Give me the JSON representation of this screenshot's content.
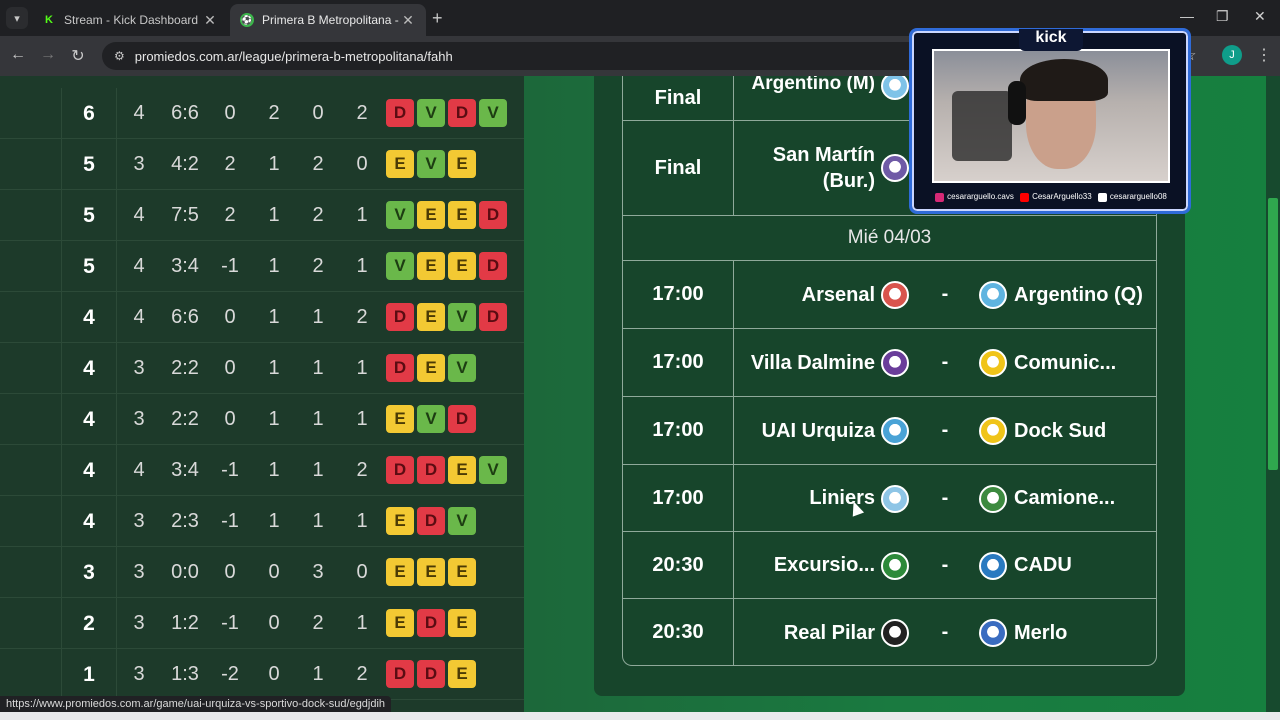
{
  "browser": {
    "tabs": [
      {
        "title": "Stream - Kick Dashboard",
        "favicon": "K",
        "active": false
      },
      {
        "title": "Primera B Metropolitana - POSI",
        "favicon": "⚽",
        "active": true
      }
    ],
    "new_tab_glyph": "+",
    "url": "promiedos.com.ar/league/primera-b-metropolitana/fahh",
    "profile_initial": "J",
    "status_link": "https://www.promiedos.com.ar/game/uai-urquiza-vs-sportivo-dock-sud/egdjdih"
  },
  "standings": {
    "rows": [
      {
        "pts": "6",
        "pj": "4",
        "goals": "6:6",
        "diff": "0",
        "g": "2",
        "e": "0",
        "p": "2",
        "form": [
          "D",
          "V",
          "D",
          "V"
        ]
      },
      {
        "pts": "5",
        "pj": "3",
        "goals": "4:2",
        "diff": "2",
        "g": "1",
        "e": "2",
        "p": "0",
        "form": [
          "E",
          "V",
          "E"
        ]
      },
      {
        "pts": "5",
        "pj": "4",
        "goals": "7:5",
        "diff": "2",
        "g": "1",
        "e": "2",
        "p": "1",
        "form": [
          "V",
          "E",
          "E",
          "D"
        ]
      },
      {
        "pts": "5",
        "pj": "4",
        "goals": "3:4",
        "diff": "-1",
        "g": "1",
        "e": "2",
        "p": "1",
        "form": [
          "V",
          "E",
          "E",
          "D"
        ]
      },
      {
        "pts": "4",
        "pj": "4",
        "goals": "6:6",
        "diff": "0",
        "g": "1",
        "e": "1",
        "p": "2",
        "form": [
          "D",
          "E",
          "V",
          "D"
        ]
      },
      {
        "pts": "4",
        "pj": "3",
        "goals": "2:2",
        "diff": "0",
        "g": "1",
        "e": "1",
        "p": "1",
        "form": [
          "D",
          "E",
          "V"
        ]
      },
      {
        "pts": "4",
        "pj": "3",
        "goals": "2:2",
        "diff": "0",
        "g": "1",
        "e": "1",
        "p": "1",
        "form": [
          "E",
          "V",
          "D"
        ]
      },
      {
        "pts": "4",
        "pj": "4",
        "goals": "3:4",
        "diff": "-1",
        "g": "1",
        "e": "1",
        "p": "2",
        "form": [
          "D",
          "D",
          "E",
          "V"
        ]
      },
      {
        "pts": "4",
        "pj": "3",
        "goals": "2:3",
        "diff": "-1",
        "g": "1",
        "e": "1",
        "p": "1",
        "form": [
          "E",
          "D",
          "V"
        ]
      },
      {
        "pts": "3",
        "pj": "3",
        "goals": "0:0",
        "diff": "0",
        "g": "0",
        "e": "3",
        "p": "0",
        "form": [
          "E",
          "E",
          "E"
        ]
      },
      {
        "pts": "2",
        "pj": "3",
        "goals": "1:2",
        "diff": "-1",
        "g": "0",
        "e": "2",
        "p": "1",
        "form": [
          "E",
          "D",
          "E"
        ]
      },
      {
        "pts": "1",
        "pj": "3",
        "goals": "1:3",
        "diff": "-2",
        "g": "0",
        "e": "1",
        "p": "2",
        "form": [
          "D",
          "D",
          "E"
        ]
      }
    ]
  },
  "fixtures": {
    "top_rows": [
      {
        "time": "Final",
        "home": "Argentino (M)",
        "home_logo_color": "#7fc3e8"
      },
      {
        "time": "Final",
        "home": "San Martín (Bur.)",
        "home_logo_color": "#6f5aa6"
      }
    ],
    "date_header": "Mié 04/03",
    "matches": [
      {
        "time": "17:00",
        "home": "Arsenal",
        "away": "Argentino (Q)",
        "home_logo_color": "#d9544d",
        "away_logo_color": "#5fb4e0"
      },
      {
        "time": "17:00",
        "home": "Villa Dalmine",
        "away": "Comunic...",
        "home_logo_color": "#6a3d9a",
        "away_logo_color": "#f0c419"
      },
      {
        "time": "17:00",
        "home": "UAI Urquiza",
        "away": "Dock Sud",
        "home_logo_color": "#4aa3d6",
        "away_logo_color": "#f0c419"
      },
      {
        "time": "17:00",
        "home": "Liniers",
        "away": "Camione...",
        "home_logo_color": "#8ec5e6",
        "away_logo_color": "#3c8a3f"
      },
      {
        "time": "20:30",
        "home": "Excursio...",
        "away": "CADU",
        "home_logo_color": "#2d8a3a",
        "away_logo_color": "#2a7ac0"
      },
      {
        "time": "20:30",
        "home": "Real Pilar",
        "away": "Merlo",
        "home_logo_color": "#222222",
        "away_logo_color": "#3a6cc0"
      }
    ],
    "dash": "-"
  },
  "overlay": {
    "brand": "kick",
    "socials": [
      "cesararguello.cavs",
      "CesarArguello33",
      "cesararguello08"
    ]
  },
  "colors": {
    "loss": "#e23a46",
    "win": "#6ab84a",
    "draw": "#f3c933"
  }
}
